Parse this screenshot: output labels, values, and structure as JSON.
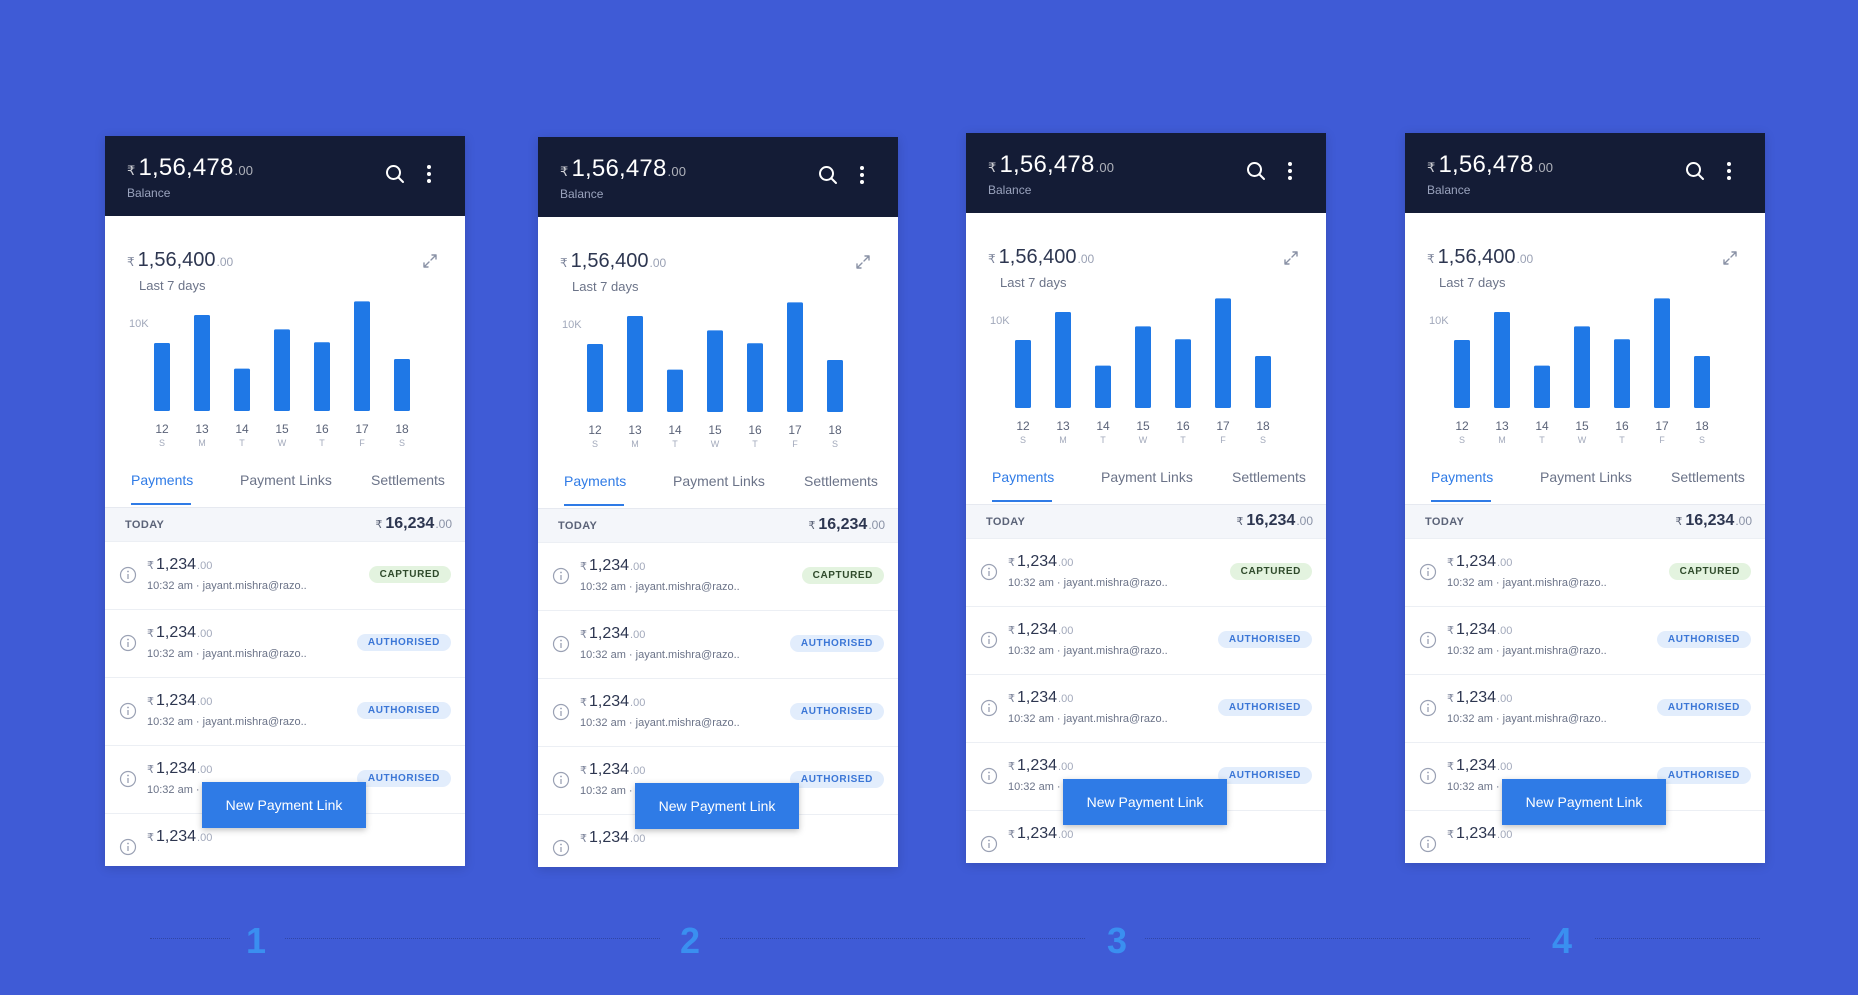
{
  "colors": {
    "background": "#3f5bd6",
    "header": "#141c36",
    "accent": "#2f7be6",
    "bar": "#1f78e6"
  },
  "screen": {
    "balance": {
      "currency": "₹",
      "whole": "1,56,478",
      "decimal": ".00",
      "label": "Balance"
    },
    "chart_header": {
      "currency": "₹",
      "whole": "1,56,400",
      "decimal": ".00",
      "period": "Last 7 days",
      "ytick": "10K"
    },
    "tabs": [
      "Payments",
      "Payment Links",
      "Settlements"
    ],
    "today": {
      "label": "TODAY",
      "currency": "₹",
      "whole": "16,234",
      "decimal": ".00"
    },
    "transactions": [
      {
        "currency": "₹",
        "whole": "1,234",
        "decimal": ".00",
        "meta": "10:32 am · jayant.mishra@razo..",
        "status": "CAPTURED"
      },
      {
        "currency": "₹",
        "whole": "1,234",
        "decimal": ".00",
        "meta": "10:32 am · jayant.mishra@razo..",
        "status": "AUTHORISED"
      },
      {
        "currency": "₹",
        "whole": "1,234",
        "decimal": ".00",
        "meta": "10:32 am · jayant.mishra@razo..",
        "status": "AUTHORISED"
      },
      {
        "currency": "₹",
        "whole": "1,234",
        "decimal": ".00",
        "meta": "10:32 am · jayant.mishra@razo..",
        "status": "AUTHORISED"
      },
      {
        "currency": "₹",
        "whole": "1,234",
        "decimal": ".00",
        "meta": "",
        "status": ""
      }
    ],
    "fab_label": "New Payment Link",
    "icons": [
      "search-icon",
      "more-vertical-icon",
      "expand-icon",
      "info-icon"
    ]
  },
  "steps": [
    "1",
    "2",
    "3",
    "4"
  ],
  "chart_data": {
    "type": "bar",
    "categories": [
      "12",
      "13",
      "14",
      "15",
      "16",
      "17",
      "18"
    ],
    "day_initials": [
      "S",
      "M",
      "T",
      "W",
      "T",
      "F",
      "S"
    ],
    "values": [
      8500,
      12000,
      5300,
      10200,
      8600,
      13700,
      6500
    ],
    "ytick_label": "10K",
    "ylim": [
      0,
      14000
    ],
    "grid": false
  }
}
